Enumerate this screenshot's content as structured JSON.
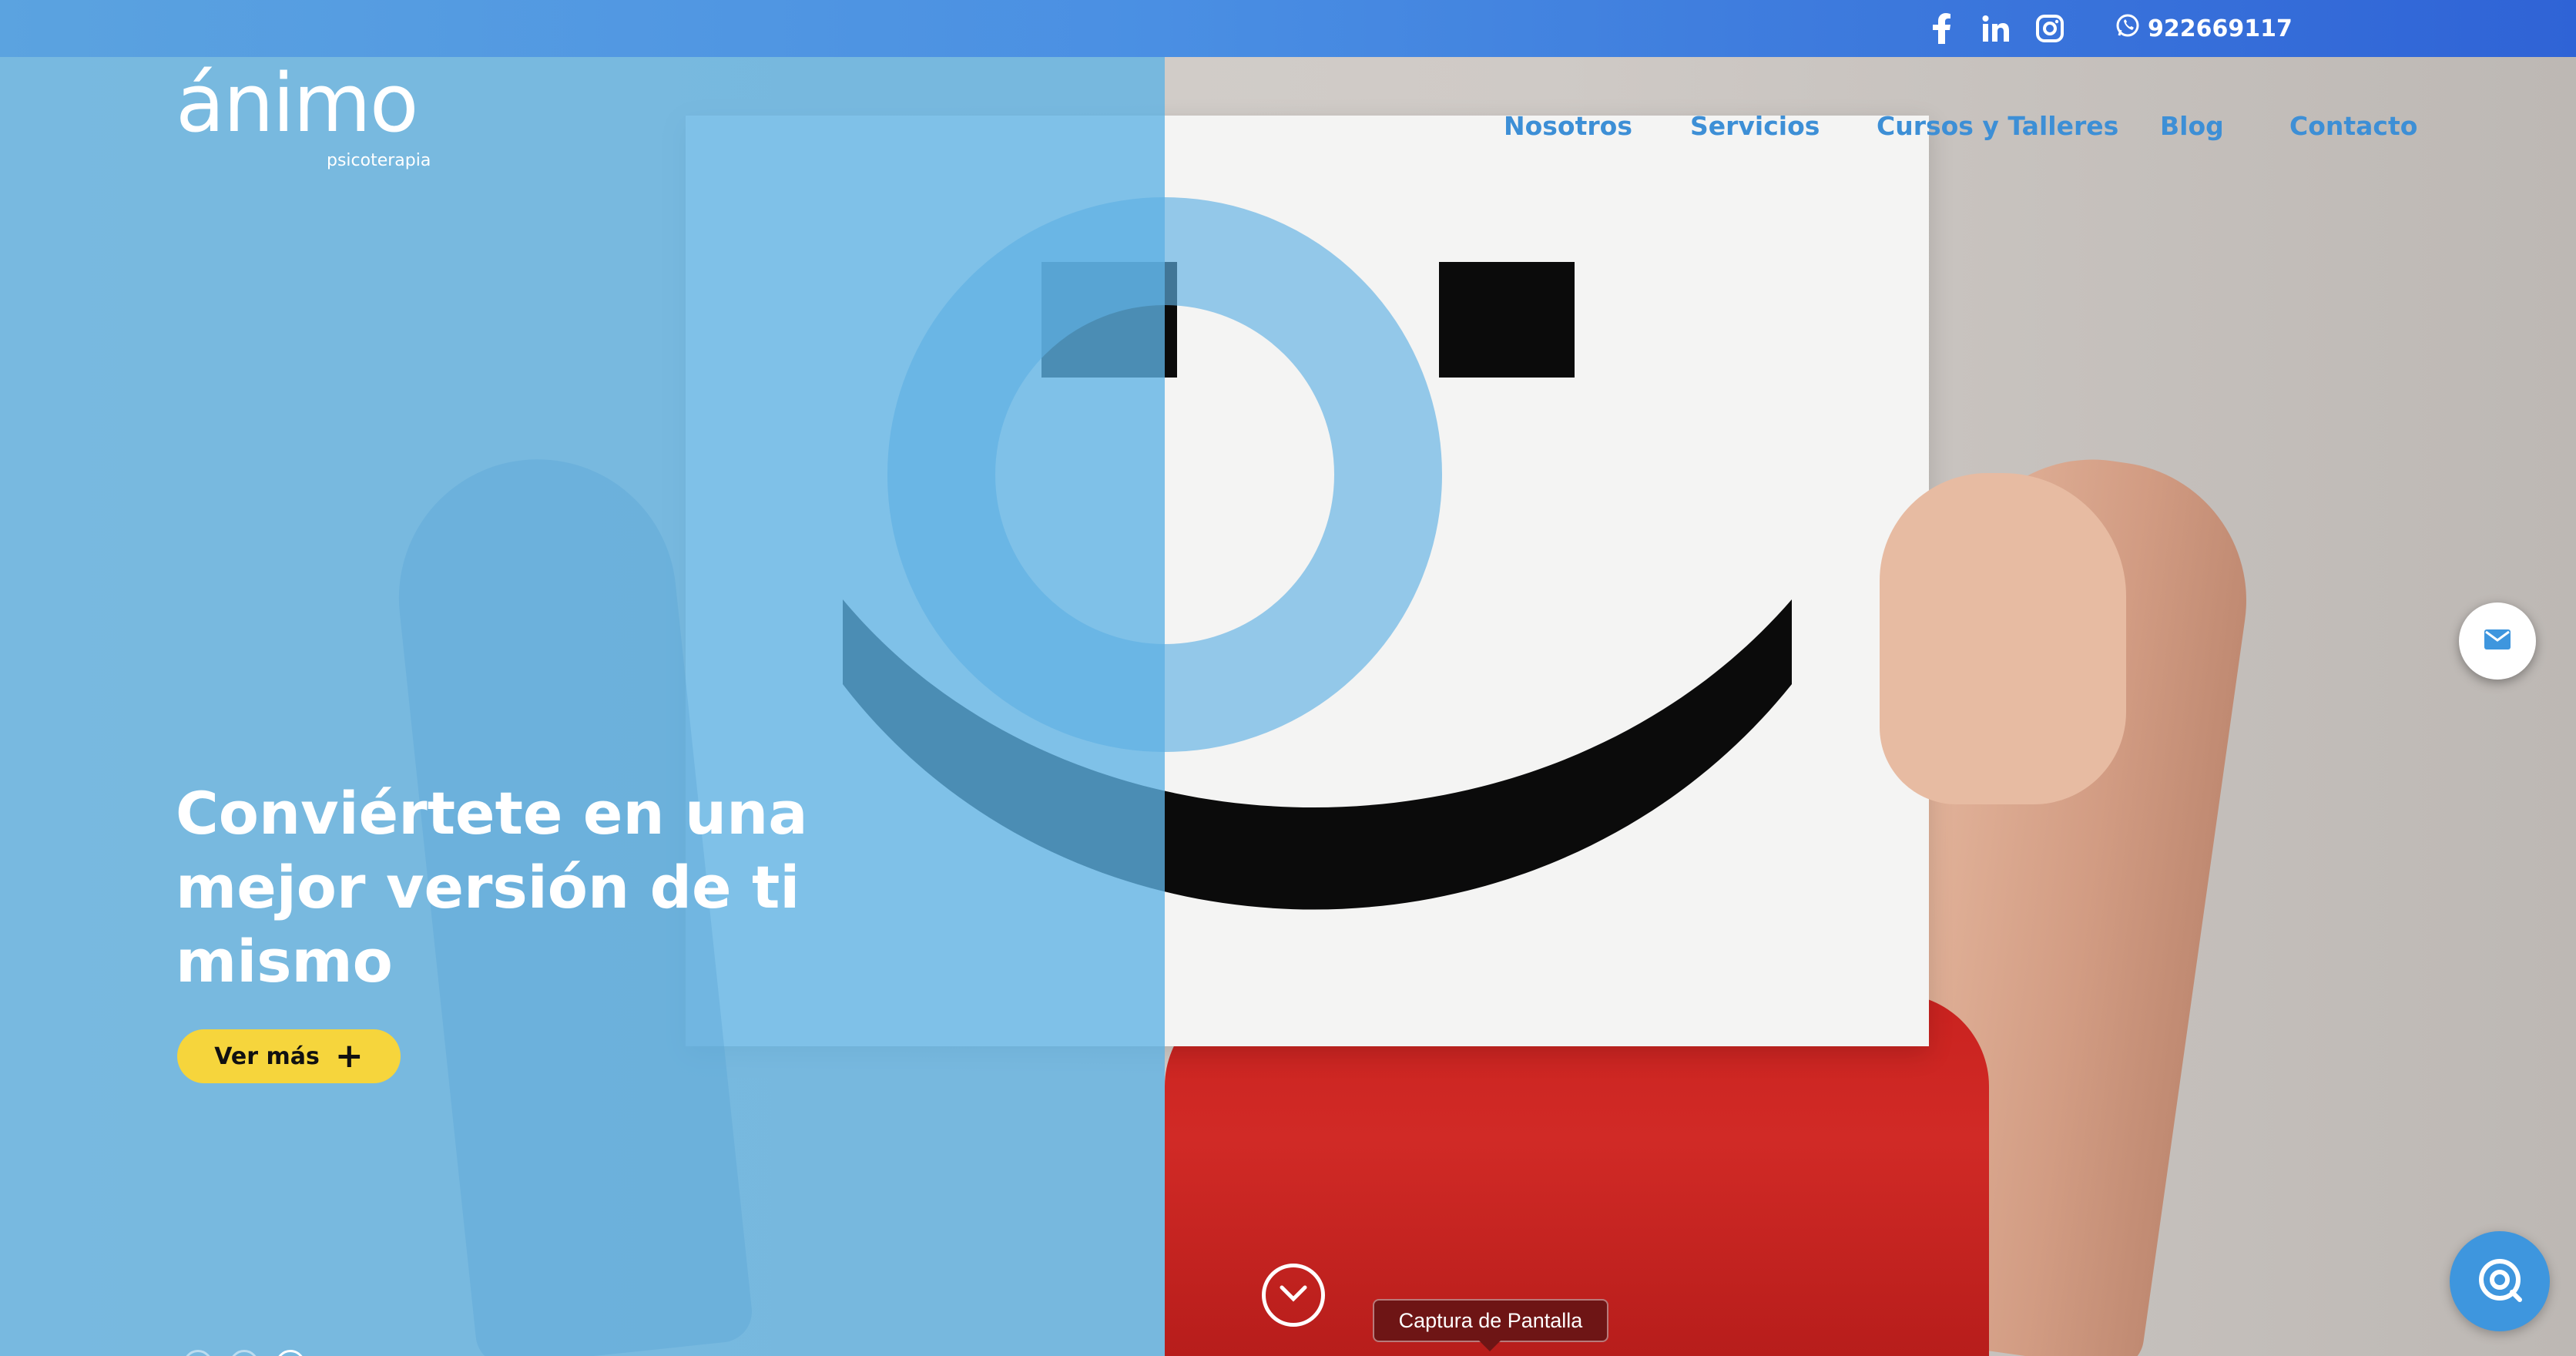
{
  "topbar": {
    "socials": [
      {
        "icon": "facebook-icon",
        "glyph": "f"
      },
      {
        "icon": "linkedin-icon",
        "glyph": "in"
      },
      {
        "icon": "instagram-icon",
        "glyph": ""
      }
    ],
    "phone": "922669117",
    "phone_icon": "whatsapp-icon"
  },
  "logo": {
    "wordmark": "ánimo",
    "tagline": "psicoterapia"
  },
  "nav": {
    "items": [
      "Nosotros",
      "Servicios",
      "Cursos y Talleres",
      "Blog",
      "Contacto"
    ]
  },
  "hero": {
    "headline_line1": "Conviértete en una",
    "headline_line2": "mejor versión de ti",
    "headline_line3": "mismo",
    "cta_label": "Ver más",
    "cta_icon": "plus-icon",
    "slides_total": 3,
    "slide_active": 3,
    "scroll_icon": "chevron-down-icon"
  },
  "tooltip": {
    "text": "Captura de Pantalla"
  },
  "floating": {
    "mail_icon": "mail-icon",
    "chat_icon": "chat-icon"
  },
  "colors": {
    "accent": "#3d8fd6",
    "cta": "#f6d53c",
    "overlay": "#5eb2e4",
    "topbar_start": "#5ba3e0",
    "topbar_end": "#2f63d6"
  }
}
